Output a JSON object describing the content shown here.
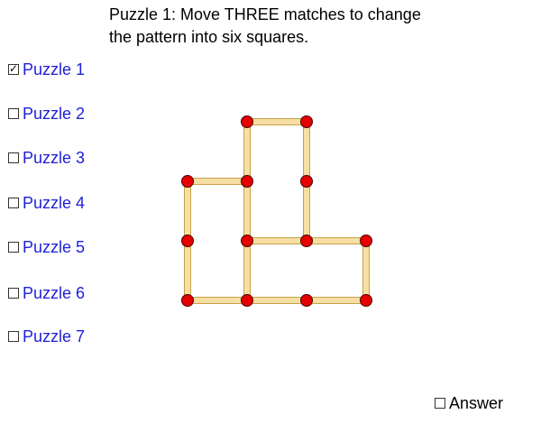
{
  "instructions": {
    "line1": "Puzzle 1:  Move THREE matches to change",
    "line2": "the pattern into six squares."
  },
  "puzzles": [
    {
      "label": "Puzzle 1",
      "checked": true
    },
    {
      "label": "Puzzle 2",
      "checked": false
    },
    {
      "label": "Puzzle 3",
      "checked": false
    },
    {
      "label": "Puzzle 4",
      "checked": false
    },
    {
      "label": "Puzzle 5",
      "checked": false
    },
    {
      "label": "Puzzle 6",
      "checked": false
    },
    {
      "label": "Puzzle 7",
      "checked": false
    }
  ],
  "answer": {
    "label": "Answer",
    "checked": false
  },
  "checkmark_glyph": "✓",
  "colors": {
    "match_fill": "#f6dfa2",
    "match_edge": "#c9a24a",
    "head_fill": "#e60000",
    "head_edge": "#4a0000",
    "link": "#1d1fd8"
  },
  "board": {
    "grid_lattice": [
      [
        0,
        0
      ],
      [
        1,
        0
      ],
      [
        1,
        2
      ],
      [
        2,
        1
      ],
      [
        2,
        2
      ],
      [
        3,
        1
      ],
      [
        2,
        -1
      ],
      [
        2,
        3
      ],
      [
        2,
        4
      ],
      [
        2,
        5
      ],
      [
        3,
        5
      ],
      [
        3,
        6
      ],
      [
        3,
        7
      ],
      [
        3,
        8
      ]
    ],
    "points": {
      "A": [
        1,
        0
      ],
      "B": [
        2,
        0
      ],
      "C": [
        0,
        1
      ],
      "D": [
        1,
        1
      ],
      "E": [
        2,
        1
      ],
      "F": [
        0,
        2
      ],
      "G": [
        1,
        2
      ],
      "H": [
        2,
        2
      ],
      "I": [
        3,
        2
      ],
      "J": [
        0,
        3
      ],
      "K": [
        1,
        3
      ],
      "L": [
        2,
        3
      ],
      "M": [
        3,
        3
      ]
    },
    "matches": [
      [
        "A",
        "B"
      ],
      [
        "A",
        "D"
      ],
      [
        "B",
        "E"
      ],
      [
        "C",
        "D"
      ],
      [
        "C",
        "F"
      ],
      [
        "D",
        "G"
      ],
      [
        "E",
        "H"
      ],
      [
        "G",
        "H"
      ],
      [
        "H",
        "I"
      ],
      [
        "F",
        "J"
      ],
      [
        "G",
        "K"
      ],
      [
        "I",
        "M"
      ],
      [
        "J",
        "K"
      ],
      [
        "K",
        "L"
      ],
      [
        "L",
        "M"
      ]
    ]
  }
}
